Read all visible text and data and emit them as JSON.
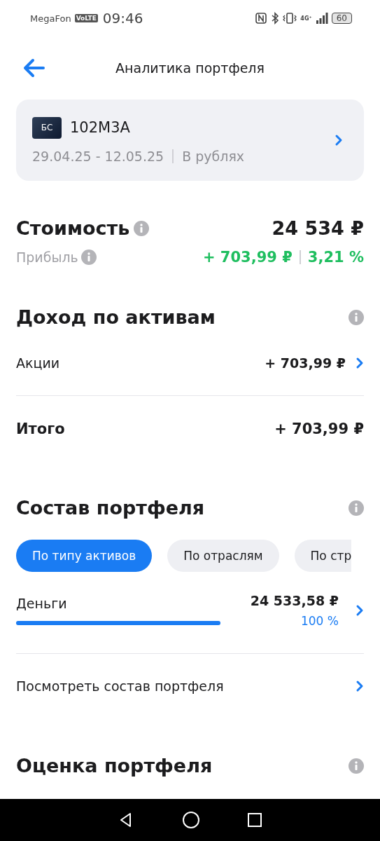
{
  "status_bar": {
    "carrier": "MegaFon",
    "volte": "VoLTE",
    "time": "09:46",
    "network": "4G⁺",
    "battery": "60"
  },
  "header": {
    "title": "Аналитика портфеля"
  },
  "account": {
    "badge": "БС",
    "name": "102M3A",
    "period": "29.04.25 - 12.05.25",
    "currency": "В рублях"
  },
  "summary": {
    "value_label": "Стоимость",
    "value": "24 534 ₽",
    "profit_label": "Прибыль",
    "profit": "+ 703,99 ₽",
    "profit_percent": "3,21 %"
  },
  "income": {
    "title": "Доход по активам",
    "rows": [
      {
        "label": "Акции",
        "value": "+ 703,99 ₽"
      }
    ],
    "total_label": "Итого",
    "total": "+ 703,99 ₽"
  },
  "composition": {
    "title": "Состав портфеля",
    "chips": [
      {
        "label": "По типу активов",
        "selected": true
      },
      {
        "label": "По отраслям",
        "selected": false
      },
      {
        "label": "По стр",
        "selected": false
      }
    ],
    "items": [
      {
        "label": "Деньги",
        "value": "24 533,58 ₽",
        "percent": "100 %",
        "level": 1
      }
    ],
    "link": "Посмотреть состав портфеля"
  },
  "valuation": {
    "title": "Оценка портфеля"
  }
}
